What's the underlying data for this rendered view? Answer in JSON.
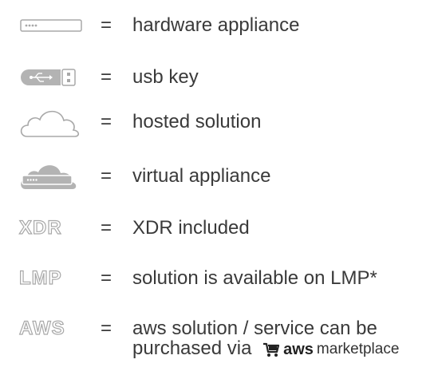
{
  "legend": {
    "separator": "=",
    "items": [
      {
        "icon": "hardware-appliance-icon",
        "label": "hardware appliance"
      },
      {
        "icon": "usb-key-icon",
        "label": "usb key"
      },
      {
        "icon": "cloud-icon",
        "label": "hosted solution"
      },
      {
        "icon": "cloud-appliance-icon",
        "label": "virtual appliance"
      },
      {
        "icon_text": "XDR",
        "label": "XDR included"
      },
      {
        "icon_text": "LMP",
        "label": "solution is available on LMP*"
      },
      {
        "icon_text": "AWS",
        "label_line1": "aws solution / service can be",
        "label_line2": "purchased via"
      }
    ],
    "marketplace": {
      "aws": "aws",
      "marketplace": "marketplace"
    }
  },
  "colors": {
    "icon_gray": "#a8a8a8",
    "icon_fill_gray": "#b3b3b3",
    "text": "#3a3a3a"
  }
}
